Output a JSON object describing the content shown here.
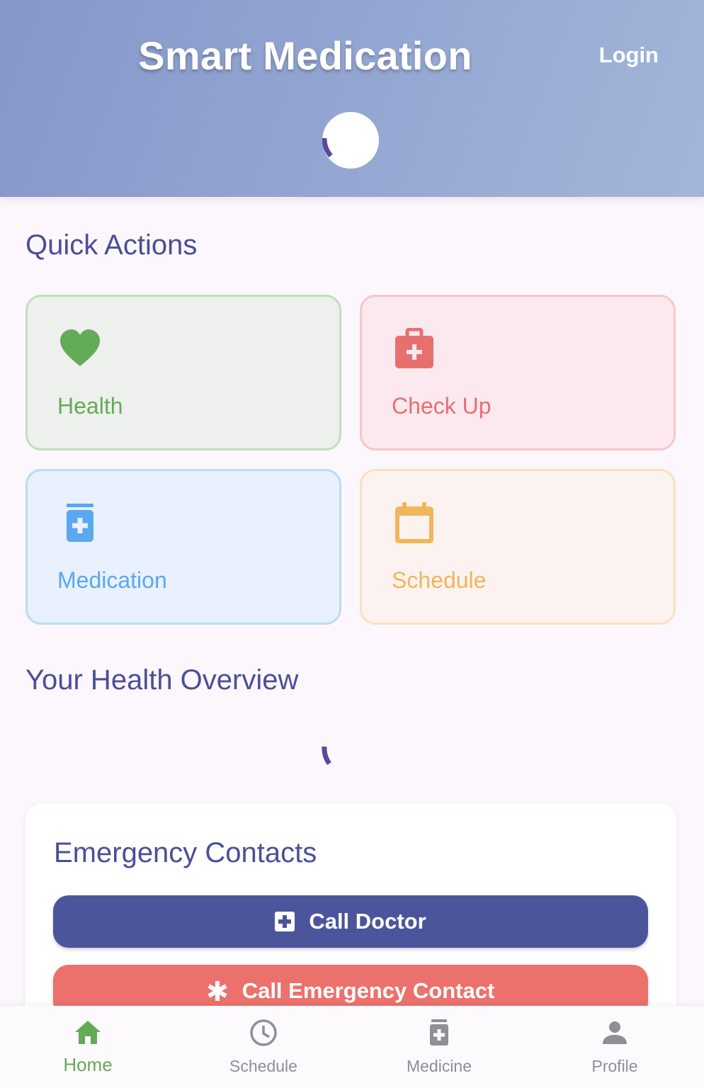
{
  "header": {
    "title": "Smart Medication",
    "login_label": "Login"
  },
  "quick_actions": {
    "title": "Quick Actions",
    "cards": [
      {
        "label": "Health",
        "icon": "heart-icon",
        "color": "#63ab56"
      },
      {
        "label": "Check Up",
        "icon": "medical-kit-icon",
        "color": "#e7706e"
      },
      {
        "label": "Medication",
        "icon": "medicine-bottle-icon",
        "color": "#5aa8ef"
      },
      {
        "label": "Schedule",
        "icon": "calendar-icon",
        "color": "#f1b55a"
      }
    ]
  },
  "overview": {
    "title": "Your Health Overview"
  },
  "emergency": {
    "title": "Emergency Contacts",
    "call_doctor_label": "Call Doctor",
    "call_emergency_label": "Call Emergency Contact",
    "doctor_color": "#4c559b",
    "emergency_color": "#ec716c"
  },
  "nav": {
    "items": [
      {
        "label": "Home",
        "icon": "home-icon",
        "active": true
      },
      {
        "label": "Schedule",
        "icon": "clock-icon",
        "active": false
      },
      {
        "label": "Medicine",
        "icon": "medicine-bottle-icon",
        "active": false
      },
      {
        "label": "Profile",
        "icon": "person-icon",
        "active": false
      }
    ],
    "active_color": "#63ab56",
    "inactive_color": "#8f8f95"
  }
}
